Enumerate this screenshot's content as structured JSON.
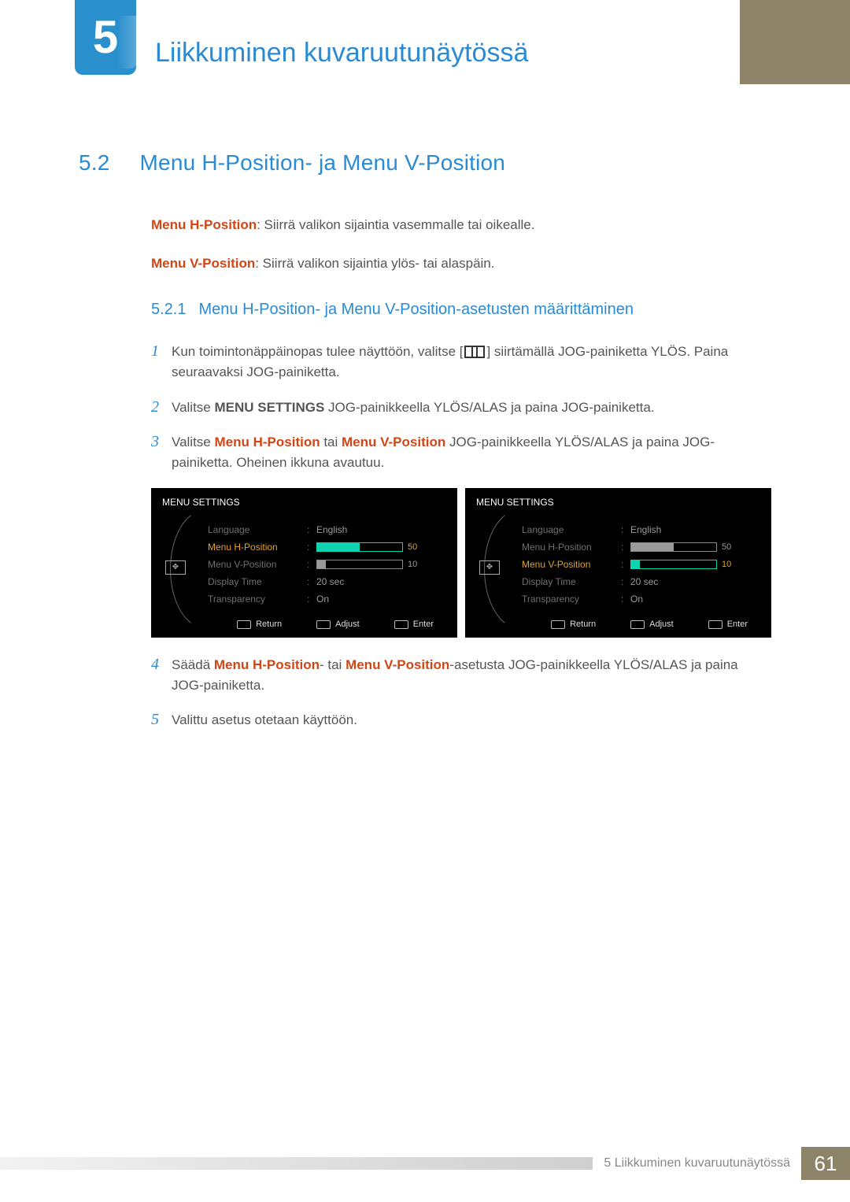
{
  "chapter": {
    "number": "5",
    "title": "Liikkuminen kuvaruutunäytössä"
  },
  "section": {
    "number": "5.2",
    "title": "Menu H-Position- ja Menu V-Position"
  },
  "intro": {
    "h_label": "Menu H-Position",
    "h_text": ": Siirrä valikon sijaintia vasemmalle tai oikealle.",
    "v_label": "Menu V-Position",
    "v_text": ": Siirrä valikon sijaintia ylös- tai alaspäin."
  },
  "subsection": {
    "number": "5.2.1",
    "title": "Menu H-Position- ja Menu V-Position-asetusten määrittäminen"
  },
  "steps": {
    "s1a": "Kun toimintonäppäinopas tulee näyttöön, valitse [",
    "s1b": "] siirtämällä JOG-painiketta YLÖS. Paina seuraavaksi JOG-painiketta.",
    "s2a": "Valitse ",
    "s2_bold": "MENU SETTINGS",
    "s2b": " JOG-painikkeella YLÖS/ALAS ja paina JOG-painiketta.",
    "s3a": "Valitse ",
    "s3_term1": "Menu H-Position",
    "s3_mid": " tai ",
    "s3_term2": "Menu V-Position",
    "s3b": " JOG-painikkeella YLÖS/ALAS ja paina JOG-painiketta. Oheinen ikkuna avautuu.",
    "s4a": "Säädä ",
    "s4_term1": "Menu H-Position",
    "s4_mid": "- tai ",
    "s4_term2": "Menu V-Position",
    "s4b": "-asetusta JOG-painikkeella YLÖS/ALAS ja paina JOG-painiketta.",
    "s5": "Valittu asetus otetaan käyttöön."
  },
  "osd": {
    "title": "MENU SETTINGS",
    "rows": {
      "language": "Language",
      "hpos": "Menu H-Position",
      "vpos": "Menu V-Position",
      "display_time": "Display Time",
      "transparency": "Transparency"
    },
    "values": {
      "language": "English",
      "hpos": "50",
      "vpos": "10",
      "display_time": "20 sec",
      "transparency": "On"
    },
    "footer": {
      "return": "Return",
      "adjust": "Adjust",
      "enter": "Enter"
    }
  },
  "footer": {
    "text": "5 Liikkuminen kuvaruutunäytössä",
    "page": "61"
  }
}
